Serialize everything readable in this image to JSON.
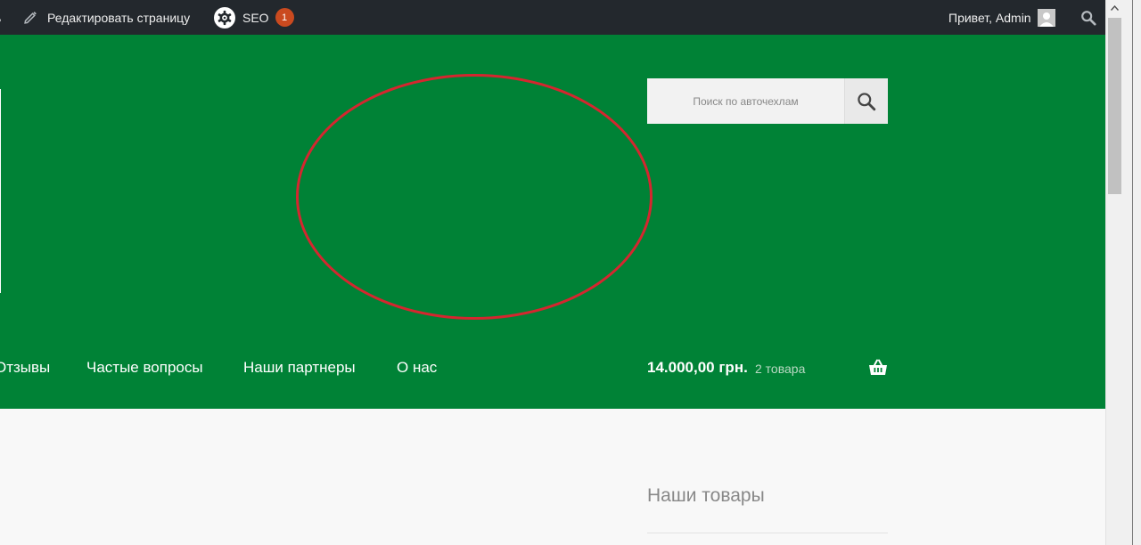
{
  "admin_bar": {
    "cut_label": "ь",
    "edit_page": "Редактировать страницу",
    "seo_label": "SEO",
    "seo_count": "1",
    "greeting": "Привет, Admin"
  },
  "header": {
    "search": {
      "placeholder": "Поиск по авточехлам"
    },
    "nav": [
      "Отзывы",
      "Частые вопросы",
      "Наши партнеры",
      "О нас"
    ],
    "cart": {
      "total": "14.000,00 грн.",
      "count": "2 товара"
    }
  },
  "sidebar": {
    "widget_title": "Наши товары"
  },
  "colors": {
    "header_bg": "#008236",
    "admin_bar_bg": "#23282d",
    "annotation": "#d5262f",
    "badge": "#ca4a1f"
  },
  "icons": [
    "pencil-icon",
    "seo-gear-icon",
    "user-avatar-icon",
    "search-icon",
    "basket-icon"
  ]
}
